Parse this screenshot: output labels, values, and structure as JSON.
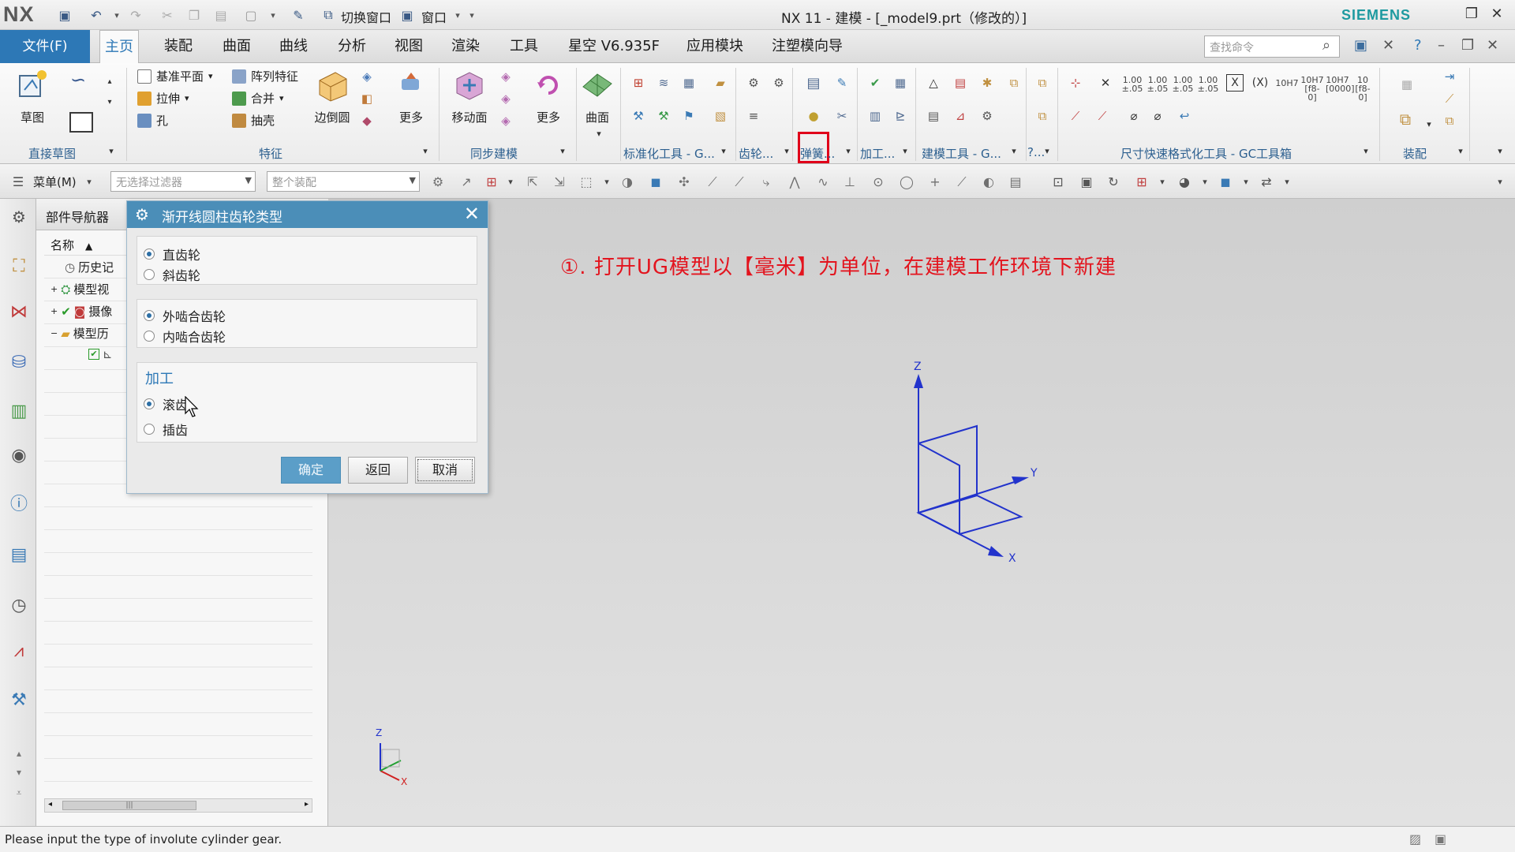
{
  "app": {
    "logo": "NX",
    "title": "NX 11 - 建模 - [_model9.prt（修改的）]",
    "brand": "SIEMENS",
    "quick_access": {
      "switch_window": "切换窗口",
      "window": "窗口"
    }
  },
  "menu": {
    "file": "文件(F)",
    "tabs": [
      "主页",
      "装配",
      "曲面",
      "曲线",
      "分析",
      "视图",
      "渲染",
      "工具",
      "星空 V6.935F",
      "应用模块",
      "注塑模向导"
    ],
    "active_tab": "主页",
    "search_placeholder": "查找命令"
  },
  "ribbon": {
    "sketch": "草图",
    "datum_plane": "基准平面",
    "extrude": "拉伸",
    "hole": "孔",
    "pattern_feature": "阵列特征",
    "unite": "合并",
    "shell": "抽壳",
    "edge_blend": "边倒圆",
    "more_feature": "更多",
    "move_face": "移动面",
    "more_sync": "更多",
    "surface": "曲面",
    "groups": {
      "direct_sketch": "直接草图",
      "feature": "特征",
      "sync_modeling": "同步建模",
      "std_tools": "标准化工具 - G...",
      "gear": "齿轮...",
      "spring": "弹簧...",
      "machining": "加工...",
      "modeling_tools": "建模工具 - G...",
      "p": "?...",
      "dim_format": "尺寸快速格式化工具 - GC工具箱",
      "assembly": "装配"
    },
    "dim_labels": [
      "1.00 ±.05",
      "1.00 ±.05",
      "1.00 ±.05",
      "1.00 ±.05",
      "10H7",
      "10H7 [f8-0]",
      "10H7 [0000]",
      "10 [f8-0]"
    ]
  },
  "selection_bar": {
    "menu": "菜单(M)",
    "filter": "无选择过滤器",
    "scope": "整个装配"
  },
  "navigator": {
    "title": "部件导航器",
    "column": "名称",
    "items": [
      "历史记",
      "模型视",
      "摄像",
      "模型历"
    ]
  },
  "dialog": {
    "title": "渐开线圆柱齿轮类型",
    "gear_type": {
      "options": [
        "直齿轮",
        "斜齿轮"
      ],
      "selected": "直齿轮"
    },
    "mesh_type": {
      "options": [
        "外啮合齿轮",
        "内啮合齿轮"
      ],
      "selected": "外啮合齿轮"
    },
    "machining": {
      "title": "加工",
      "options": [
        "滚齿",
        "插齿"
      ],
      "selected": "滚齿"
    },
    "buttons": {
      "ok": "确定",
      "back": "返回",
      "cancel": "取消"
    }
  },
  "graphics": {
    "annotation": "①. 打开UG模型以【毫米】为单位，在建模工作环境下新建",
    "axis_labels": {
      "z": "Z",
      "y": "Y",
      "x": "X"
    },
    "triad_labels": {
      "z": "Z",
      "x": "X"
    }
  },
  "status": {
    "message": "Please input the type of involute cylinder gear."
  },
  "colors": {
    "accent": "#2d78b6",
    "dialog_title": "#4b8eb8",
    "annotation": "#e3141e",
    "datum_csys": "#2233cc",
    "highlight_box": "#e0001a"
  }
}
